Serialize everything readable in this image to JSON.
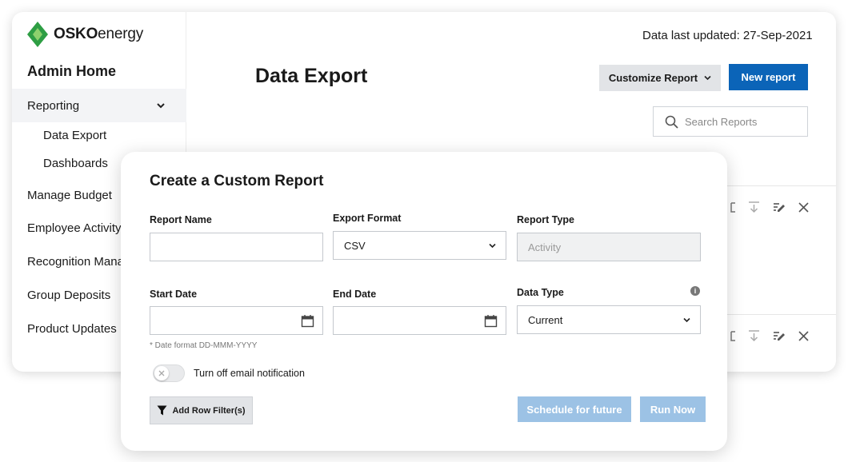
{
  "brand": {
    "name_bold": "OSKO",
    "name_rest": "energy",
    "accent": "#2e9e44"
  },
  "header": {
    "last_updated": "Data last updated: 27-Sep-2021"
  },
  "sidebar": {
    "title": "Admin Home",
    "reporting": "Reporting",
    "sub_items": [
      "Data Export",
      "Dashboards"
    ],
    "items": [
      "Manage Budget",
      "Employee Activity",
      "Recognition Mana",
      "Group Deposits",
      "Product Updates"
    ]
  },
  "main": {
    "title": "Data Export",
    "customize_label": "Customize Report",
    "new_report_label": "New report",
    "search_placeholder": "Search Reports"
  },
  "modal": {
    "title": "Create a Custom Report",
    "report_name": {
      "label": "Report Name",
      "value": ""
    },
    "export_format": {
      "label": "Export Format",
      "value": "CSV"
    },
    "report_type": {
      "label": "Report Type",
      "value": "Activity"
    },
    "start_date": {
      "label": "Start Date",
      "value": ""
    },
    "end_date": {
      "label": "End Date",
      "value": ""
    },
    "data_type": {
      "label": "Data Type",
      "value": "Current"
    },
    "date_hint": "* Date format DD-MMM-YYYY",
    "email_toggle": {
      "label": "Turn off email notification",
      "on": false
    },
    "add_filter_label": "Add Row Filter(s)",
    "schedule_label": "Schedule for future",
    "run_label": "Run Now"
  },
  "colors": {
    "primary": "#0b64b8",
    "disabled_primary": "#9cc2e5"
  }
}
